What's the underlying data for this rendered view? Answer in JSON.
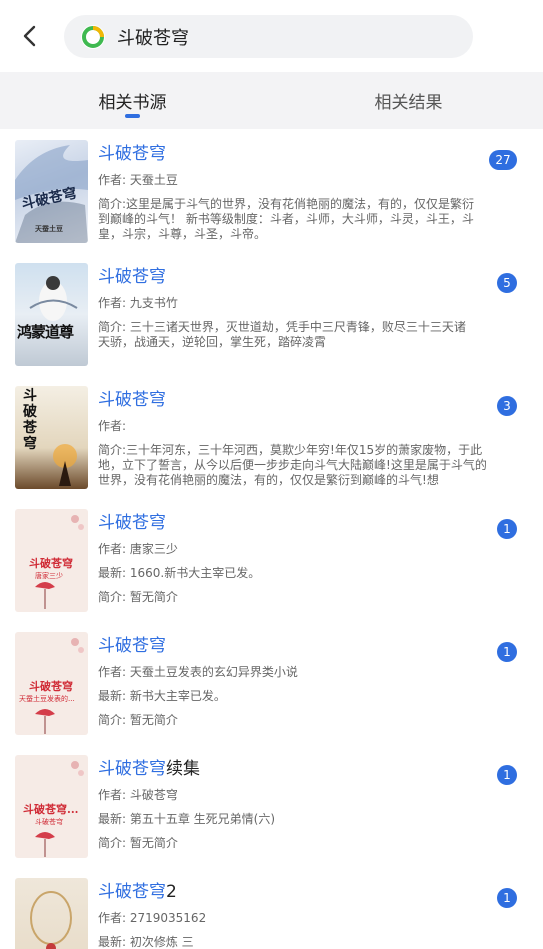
{
  "search": {
    "query": "斗破苍穹"
  },
  "tabs": [
    {
      "label": "相关书源"
    },
    {
      "label": "相关结果"
    }
  ],
  "results": [
    {
      "title_hl": "斗破苍穹",
      "title_rest": "",
      "count": "27",
      "author": "作者: 天蚕土豆",
      "lines": [
        "简介:这里是属于斗气的世界，没有花俏艳丽的魔法，有的，仅仅是繁衍",
        "到巅峰的斗气！ 新书等级制度：斗者，斗师，大斗师，斗灵，斗王，斗",
        "皇，斗宗，斗尊，斗圣，斗帝。"
      ],
      "cover": {
        "text1": "斗破苍穹",
        "text2": "天蚕土豆"
      }
    },
    {
      "title_hl": "斗破苍穹",
      "title_rest": "",
      "count": "5",
      "author": "作者: 九支书竹",
      "lines": [
        "简介:       三十三诸天世界，灭世道劫，凭手中三尺青锋，败尽三十三天诸",
        "天骄，战通天，逆轮回，掌生死，踏碎凌霄"
      ],
      "cover": {
        "text1": "鸿蒙道尊",
        "text2": ""
      }
    },
    {
      "title_hl": "斗破苍穹",
      "title_rest": "",
      "count": "3",
      "author": "作者:",
      "lines": [
        "简介:三十年河东，三十年河西，莫欺少年穷!年仅15岁的萧家废物，于此",
        "地，立下了誓言，从今以后便一步步走向斗气大陆巅峰!这里是属于斗气的",
        "世界，没有花俏艳丽的魔法，有的，仅仅是繁衍到巅峰的斗气!想"
      ],
      "cover": {
        "text1": "斗破苍穹",
        "text2": ""
      }
    },
    {
      "title_hl": "斗破苍穹",
      "title_rest": "",
      "count": "1",
      "author": "作者: 唐家三少",
      "latest": "最新: 1660.新书大主宰已发。",
      "intro": "简介: 暂无简介",
      "cover": {
        "text1": "斗破苍穹",
        "text2": "唐家三少"
      }
    },
    {
      "title_hl": "斗破苍穹",
      "title_rest": "",
      "count": "1",
      "author": "作者: 天蚕土豆发表的玄幻异界类小说",
      "latest": "最新: 新书大主宰已发。",
      "intro": "简介: 暂无简介",
      "cover": {
        "text1": "斗破苍穹",
        "text2": "天蚕土豆发表的..."
      }
    },
    {
      "title_hl": "斗破苍穹",
      "title_rest": "续集",
      "count": "1",
      "author": "作者: 斗破苍穹",
      "latest": "最新: 第五十五章 生死兄弟情(六)",
      "intro": "简介: 暂无简介",
      "cover": {
        "text1": "斗破苍穹...",
        "text2": "斗破苍穹"
      }
    },
    {
      "title_hl": "斗破苍穹",
      "title_rest": "2",
      "count": "1",
      "author": "作者: 2719035162",
      "latest": "最新: 初次修炼 三",
      "intro": "",
      "cover": {
        "text1": "",
        "text2": ""
      }
    }
  ],
  "colors": {
    "accent": "#2f6ee0",
    "tab_bg": "#f3f3f5",
    "search_bg": "#f1f2f4"
  }
}
